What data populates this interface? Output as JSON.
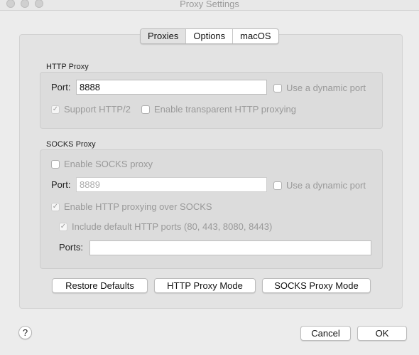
{
  "window": {
    "title": "Proxy Settings"
  },
  "tabs": [
    {
      "label": "Proxies",
      "selected": true
    },
    {
      "label": "Options",
      "selected": false
    },
    {
      "label": "macOS",
      "selected": false
    }
  ],
  "http_proxy": {
    "group_label": "HTTP Proxy",
    "port_label": "Port:",
    "port_value": "8888",
    "dynamic_port": {
      "label": "Use a dynamic port",
      "checked": false,
      "enabled": false
    },
    "support_http2": {
      "label": "Support HTTP/2",
      "checked": true,
      "enabled": false
    },
    "transparent": {
      "label": "Enable transparent HTTP proxying",
      "checked": false,
      "enabled": false
    }
  },
  "socks_proxy": {
    "group_label": "SOCKS Proxy",
    "enable": {
      "label": "Enable SOCKS proxy",
      "checked": false,
      "enabled": false
    },
    "port_label": "Port:",
    "port_value": "8889",
    "dynamic_port": {
      "label": "Use a dynamic port",
      "checked": false,
      "enabled": false
    },
    "http_over_socks": {
      "label": "Enable HTTP proxying over SOCKS",
      "checked": true,
      "enabled": false
    },
    "include_default_ports": {
      "label": "Include default HTTP ports (80, 443, 8080, 8443)",
      "checked": true,
      "enabled": false
    },
    "ports_label": "Ports:",
    "ports_value": ""
  },
  "actions": {
    "restore_defaults": "Restore Defaults",
    "http_proxy_mode": "HTTP Proxy Mode",
    "socks_proxy_mode": "SOCKS Proxy Mode"
  },
  "footer": {
    "help": "?",
    "cancel": "Cancel",
    "ok": "OK"
  },
  "icons": {
    "check": "checkmark-icon",
    "help": "help-icon"
  }
}
